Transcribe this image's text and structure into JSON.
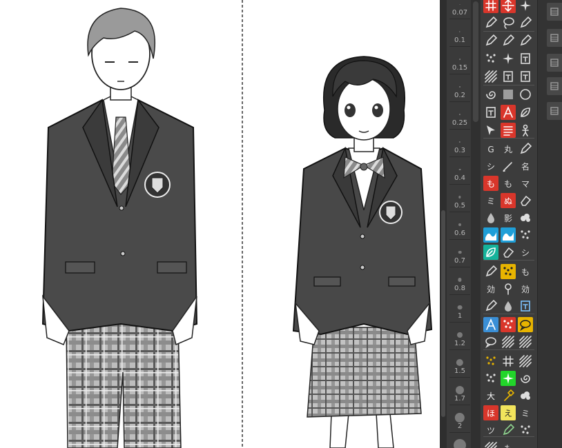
{
  "brush_sizes": [
    {
      "label": "0.07",
      "r": 0.5
    },
    {
      "label": "0.1",
      "r": 0.7
    },
    {
      "label": "0.15",
      "r": 0.9
    },
    {
      "label": "0.2",
      "r": 1.0
    },
    {
      "label": "0.25",
      "r": 1.1
    },
    {
      "label": "0.3",
      "r": 1.2
    },
    {
      "label": "0.4",
      "r": 1.4
    },
    {
      "label": "0.5",
      "r": 1.7
    },
    {
      "label": "0.6",
      "r": 2.0
    },
    {
      "label": "0.7",
      "r": 2.3
    },
    {
      "label": "0.8",
      "r": 2.6
    },
    {
      "label": "1",
      "r": 3.4
    },
    {
      "label": "1.2",
      "r": 4.0
    },
    {
      "label": "1.5",
      "r": 5.2
    },
    {
      "label": "1.7",
      "r": 6.0
    },
    {
      "label": "2",
      "r": 7.2
    },
    {
      "label": "",
      "r": 9.0
    }
  ],
  "tools": [
    {
      "name": "cross-hatch-tool-icon",
      "bg": "#d9362b",
      "fg": "#fff",
      "glyph": "grid"
    },
    {
      "name": "expand-arrows-tool-icon",
      "bg": "#d9362b",
      "fg": "#fff",
      "glyph": "cross"
    },
    {
      "name": "sparkle-tool-icon",
      "bg": "#3c3c3c",
      "fg": "#ddd",
      "glyph": "star"
    },
    {
      "name": "eyedropper-tool-icon",
      "bg": "#3c3c3c",
      "fg": "#ddd",
      "glyph": "pen"
    },
    {
      "name": "lasso-tool-icon",
      "bg": "#3c3c3c",
      "fg": "#ddd",
      "glyph": "lasso"
    },
    {
      "name": "pen-node-tool-icon",
      "bg": "#3c3c3c",
      "fg": "#ddd",
      "glyph": "pen"
    },
    {
      "name": "pencil-tool-icon",
      "bg": "#3c3c3c",
      "fg": "#ddd",
      "glyph": "pen"
    },
    {
      "name": "g-pen-tool-icon",
      "bg": "#3c3c3c",
      "fg": "#ddd",
      "glyph": "pen"
    },
    {
      "name": "mapping-pen-tool-icon",
      "bg": "#3c3c3c",
      "fg": "#ddd",
      "glyph": "pen"
    },
    {
      "name": "spray-tool-icon",
      "bg": "#3c3c3c",
      "fg": "#ddd",
      "glyph": "dots"
    },
    {
      "name": "sparkle-brush-tool-icon",
      "bg": "#3c3c3c",
      "fg": "#ddd",
      "glyph": "star"
    },
    {
      "name": "frame-tool-icon",
      "bg": "#3c3c3c",
      "fg": "#ddd",
      "glyph": "box"
    },
    {
      "name": "hatch-line-tool-icon",
      "bg": "#3c3c3c",
      "fg": "#ddd",
      "glyph": "hatch"
    },
    {
      "name": "text-frame-tool-icon",
      "bg": "#3c3c3c",
      "fg": "#ddd",
      "glyph": "box"
    },
    {
      "name": "vertical-text-tool-icon",
      "bg": "#3c3c3c",
      "fg": "#ddd",
      "glyph": "box"
    },
    {
      "name": "blend-tool-icon",
      "bg": "#3c3c3c",
      "fg": "#ddd",
      "glyph": "swirl"
    },
    {
      "name": "gradient-tool-icon",
      "bg": "#3c3c3c",
      "fg": "#ddd",
      "glyph": "grad"
    },
    {
      "name": "circle-tool-icon",
      "bg": "#3c3c3c",
      "fg": "#ddd",
      "glyph": "circle"
    },
    {
      "name": "panel-tool-icon",
      "bg": "#3c3c3c",
      "fg": "#ddd",
      "glyph": "box"
    },
    {
      "name": "text-a-tool-icon",
      "bg": "#d9362b",
      "fg": "#fff",
      "glyph": "A"
    },
    {
      "name": "leaf-tool-icon",
      "bg": "#3c3c3c",
      "fg": "#ddd",
      "glyph": "leaf"
    },
    {
      "name": "select-arrow-tool-icon",
      "bg": "#3c3c3c",
      "fg": "#ddd",
      "glyph": "arrow"
    },
    {
      "name": "list-tool-icon",
      "bg": "#d9362b",
      "fg": "#fff",
      "glyph": "lines"
    },
    {
      "name": "figure-tool-icon",
      "bg": "#3c3c3c",
      "fg": "#ddd",
      "glyph": "person"
    },
    {
      "name": "g-pen-preset-icon",
      "bg": "#3c3c3c",
      "fg": "#ddd",
      "glyph": "G"
    },
    {
      "name": "round-pen-preset-icon",
      "bg": "#3c3c3c",
      "fg": "#ddd",
      "glyph": "丸"
    },
    {
      "name": "brush-nib-icon",
      "bg": "#3c3c3c",
      "fg": "#ddd",
      "glyph": "pen"
    },
    {
      "name": "shade-pen-icon",
      "bg": "#3c3c3c",
      "fg": "#ddd",
      "glyph": "シ"
    },
    {
      "name": "brush-stroke-icon",
      "bg": "#3c3c3c",
      "fg": "#ddd",
      "glyph": "brush"
    },
    {
      "name": "name-pen-icon",
      "bg": "#3c3c3c",
      "fg": "#ddd",
      "glyph": "名"
    },
    {
      "name": "mo-red-icon",
      "bg": "#d9362b",
      "fg": "#fff",
      "glyph": "も"
    },
    {
      "name": "mo-outline-icon",
      "bg": "#3c3c3c",
      "fg": "#ddd",
      "glyph": "も"
    },
    {
      "name": "ma-marker-icon",
      "bg": "#3c3c3c",
      "fg": "#ddd",
      "glyph": "マ"
    },
    {
      "name": "mi-brush-icon",
      "bg": "#3c3c3c",
      "fg": "#ddd",
      "glyph": "ミ"
    },
    {
      "name": "nu-fill-icon",
      "bg": "#d9362b",
      "fg": "#fff",
      "glyph": "ぬ"
    },
    {
      "name": "eraser-diag-icon",
      "bg": "#3c3c3c",
      "fg": "#ddd",
      "glyph": "eraser"
    },
    {
      "name": "water-drop-icon",
      "bg": "#3c3c3c",
      "fg": "#ddd",
      "glyph": "drop"
    },
    {
      "name": "black-shade-icon",
      "bg": "#3c3c3c",
      "fg": "#ddd",
      "glyph": "影"
    },
    {
      "name": "cloud-brush-icon",
      "bg": "#3c3c3c",
      "fg": "#ddd",
      "glyph": "cloud"
    },
    {
      "name": "wave-blue-icon",
      "bg": "#1f9fd8",
      "fg": "#fff",
      "glyph": "wave"
    },
    {
      "name": "wave-blue-alt-icon",
      "bg": "#1f9fd8",
      "fg": "#fff",
      "glyph": "wave"
    },
    {
      "name": "stack-brush-icon",
      "bg": "#3c3c3c",
      "fg": "#ddd",
      "glyph": "dots"
    },
    {
      "name": "cyan-leaf-icon",
      "bg": "#15b39b",
      "fg": "#fff",
      "glyph": "leaf"
    },
    {
      "name": "eraser-tool-icon",
      "bg": "#3c3c3c",
      "fg": "#ddd",
      "glyph": "eraser"
    },
    {
      "name": "shi-brush-icon",
      "bg": "#3c3c3c",
      "fg": "#ddd",
      "glyph": "シ"
    },
    {
      "name": "fine-pen-icon",
      "bg": "#3c3c3c",
      "fg": "#ddd",
      "glyph": "pen"
    },
    {
      "name": "yellow-pattern-icon",
      "bg": "#e8b400",
      "fg": "#222",
      "glyph": "dots"
    },
    {
      "name": "mo-line-icon",
      "bg": "#3c3c3c",
      "fg": "#ddd",
      "glyph": "も"
    },
    {
      "name": "effect-a-icon",
      "bg": "#3c3c3c",
      "fg": "#ddd",
      "glyph": "効"
    },
    {
      "name": "pin-icon",
      "bg": "#3c3c3c",
      "fg": "#ddd",
      "glyph": "pin"
    },
    {
      "name": "effect-line-icon",
      "bg": "#3c3c3c",
      "fg": "#ddd",
      "glyph": "効"
    },
    {
      "name": "ink-pen-icon",
      "bg": "#3c3c3c",
      "fg": "#ddd",
      "glyph": "pen"
    },
    {
      "name": "double-drop-icon",
      "bg": "#3c3c3c",
      "fg": "#ddd",
      "glyph": "drop"
    },
    {
      "name": "blue-frame-icon",
      "bg": "#3c3c3c",
      "fg": "#7ec3ff",
      "glyph": "box"
    },
    {
      "name": "text-tool-icon",
      "bg": "#3a8fd6",
      "fg": "#fff",
      "glyph": "A"
    },
    {
      "name": "red-block-icon",
      "bg": "#d9362b",
      "fg": "#fff",
      "glyph": "dots"
    },
    {
      "name": "speech-balloon-icon",
      "bg": "#e8b400",
      "fg": "#222",
      "glyph": "balloon"
    },
    {
      "name": "balloon-outline-icon",
      "bg": "#3c3c3c",
      "fg": "#ddd",
      "glyph": "balloon"
    },
    {
      "name": "speed-lines-icon",
      "bg": "#3c3c3c",
      "fg": "#ddd",
      "glyph": "hatch"
    },
    {
      "name": "parallel-lines-icon",
      "bg": "#3c3c3c",
      "fg": "#ddd",
      "glyph": "hatch"
    },
    {
      "name": "tone-dots-icon",
      "bg": "#3c3c3c",
      "fg": "#e8b400",
      "glyph": "dots"
    },
    {
      "name": "diamond-tone-icon",
      "bg": "#3c3c3c",
      "fg": "#ddd",
      "glyph": "grid"
    },
    {
      "name": "gradient-tone-icon",
      "bg": "#3c3c3c",
      "fg": "#ddd",
      "glyph": "hatch"
    },
    {
      "name": "noise-tone-icon",
      "bg": "#3c3c3c",
      "fg": "#ddd",
      "glyph": "dots"
    },
    {
      "name": "green-sparkle-icon",
      "bg": "#22d62a",
      "fg": "#fff",
      "glyph": "star"
    },
    {
      "name": "curl-brush-icon",
      "bg": "#3c3c3c",
      "fg": "#ddd",
      "glyph": "swirl"
    },
    {
      "name": "madara-big-icon",
      "bg": "#3c3c3c",
      "fg": "#fff",
      "glyph": "大"
    },
    {
      "name": "hammer-tool-icon",
      "bg": "#3c3c3c",
      "fg": "#e8b400",
      "glyph": "hammer"
    },
    {
      "name": "smoke-brush-icon",
      "bg": "#3c3c3c",
      "fg": "#ddd",
      "glyph": "cloud"
    },
    {
      "name": "red-flame-icon",
      "bg": "#d9362b",
      "fg": "#fff",
      "glyph": "ほ"
    },
    {
      "name": "yellow-e-icon",
      "bg": "#f2e45c",
      "fg": "#222",
      "glyph": "え"
    },
    {
      "name": "pattern-kana-icon",
      "bg": "#3c3c3c",
      "fg": "#ddd",
      "glyph": "ミ"
    },
    {
      "name": "tsuya-brush-icon",
      "bg": "#3c3c3c",
      "fg": "#ddd",
      "glyph": "ツ"
    },
    {
      "name": "green-pen-icon",
      "bg": "#3c3c3c",
      "fg": "#8fd48f",
      "glyph": "pen"
    },
    {
      "name": "bottom-a-icon",
      "bg": "#3c3c3c",
      "fg": "#ddd",
      "glyph": "dots"
    },
    {
      "name": "bottom-b-icon",
      "bg": "#3c3c3c",
      "fg": "#ddd",
      "glyph": "hatch"
    },
    {
      "name": "bottom-c-icon",
      "bg": "#3c3c3c",
      "fg": "#ddd",
      "glyph": "も"
    }
  ],
  "dock": [
    {
      "name": "dock-filmstrip-icon"
    },
    {
      "name": "dock-layers-icon"
    },
    {
      "name": "dock-pages-icon"
    },
    {
      "name": "dock-list-icon"
    },
    {
      "name": "dock-list2-icon"
    }
  ]
}
